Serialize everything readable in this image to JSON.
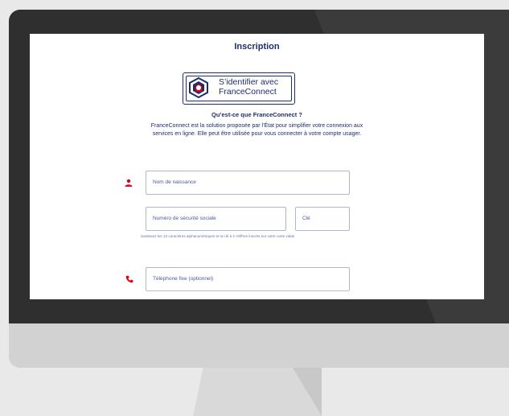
{
  "page": {
    "title": "Inscription",
    "franceconnect_button": {
      "label_line1": "S’identifier avec",
      "label_line2": "FranceConnect"
    },
    "franceconnect_question": "Qu’est-ce que FranceConnect ?",
    "franceconnect_description_line1": "FranceConnect est la solution proposée par l’État pour simplifier votre connexion aux",
    "franceconnect_description_line2": "services en ligne. Elle peut être utilisée pour vous connecter à votre compte usager."
  },
  "form": {
    "birth_name": {
      "placeholder": "Nom de naissance"
    },
    "social_security_number": {
      "placeholder": "Numéro de sécurité sociale"
    },
    "key": {
      "placeholder": "Clé"
    },
    "ssn_helper": "Saisissez les 13 caractères alphanumériques et la clé à 2 chiffres inscrits sur votre carte vitale",
    "landline_phone": {
      "placeholder": "Téléphone fixe (optionnel)"
    }
  },
  "icons": {
    "person": "person-icon",
    "phone": "phone-icon",
    "franceconnect_logo": "franceconnect-logo-icon"
  },
  "colors": {
    "brand_blue": "#1f2d6b",
    "accent_red": "#e1000f",
    "field_border": "#aeb6d6"
  }
}
